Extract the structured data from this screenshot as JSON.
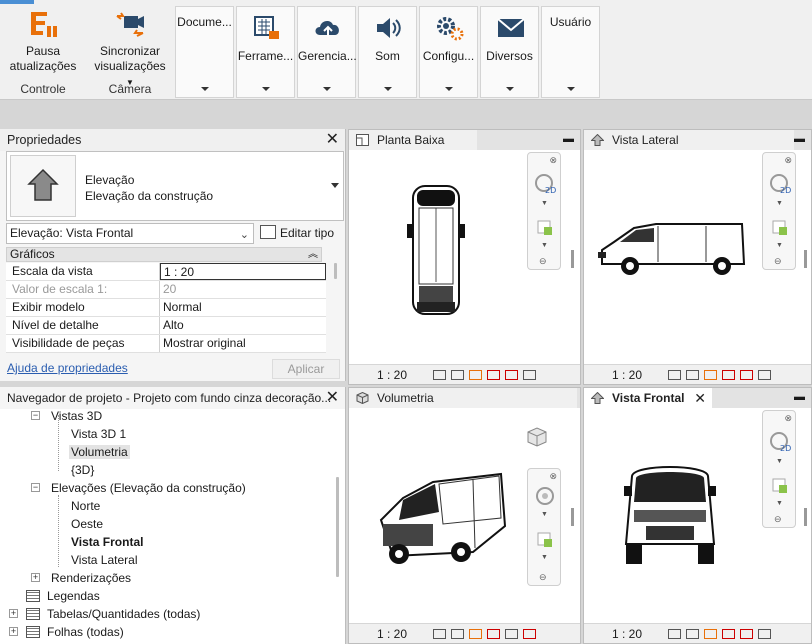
{
  "ribbon": {
    "pausa_label_1": "Pausa",
    "pausa_label_2": "atualizações",
    "sync_label_1": "Sincronizar",
    "sync_label_2": "visualizações",
    "group_controle": "Controle",
    "group_camera": "Câmera",
    "panels": [
      "Docume...",
      "Ferrame...",
      "Gerencia...",
      "Som",
      "Configu...",
      "Diversos",
      "Usuário"
    ]
  },
  "properties": {
    "title": "Propriedades",
    "type_line1": "Elevação",
    "type_line2": "Elevação da construção",
    "selector_value": "Elevação: Vista Frontal",
    "edit_type": "Editar tipo",
    "section": "Gráficos",
    "rows": [
      {
        "k": "Escala da vista",
        "v": "1 : 20"
      },
      {
        "k": "Valor de escala    1:",
        "v": "20"
      },
      {
        "k": "Exibir modelo",
        "v": "Normal"
      },
      {
        "k": "Nível de detalhe",
        "v": "Alto"
      },
      {
        "k": "Visibilidade de peças",
        "v": "Mostrar original"
      }
    ],
    "help_link": "Ajuda de propriedades",
    "apply": "Aplicar"
  },
  "browser": {
    "title": "Navegador de projeto - Projeto com fundo cinza decoração...",
    "items": [
      "Vistas 3D",
      "Vista 3D 1",
      "Volumetria",
      "{3D}",
      "Elevações (Elevação da construção)",
      "Norte",
      "Oeste",
      "Vista Frontal",
      "Vista Lateral",
      "Renderizações",
      "Legendas",
      "Tabelas/Quantidades (todas)",
      "Folhas (todas)"
    ]
  },
  "views": {
    "planta": {
      "title": "Planta Baixa",
      "scale": "1 : 20"
    },
    "lateral": {
      "title": "Vista Lateral",
      "scale": "1 : 20"
    },
    "volumetria": {
      "title": "Volumetria",
      "scale": "1 : 20"
    },
    "frontal": {
      "title": "Vista Frontal",
      "scale": "1 : 20"
    }
  },
  "colors": {
    "accent": "#4a8fd4",
    "pause_orange": "#e8700a",
    "link": "#2a5db0"
  }
}
